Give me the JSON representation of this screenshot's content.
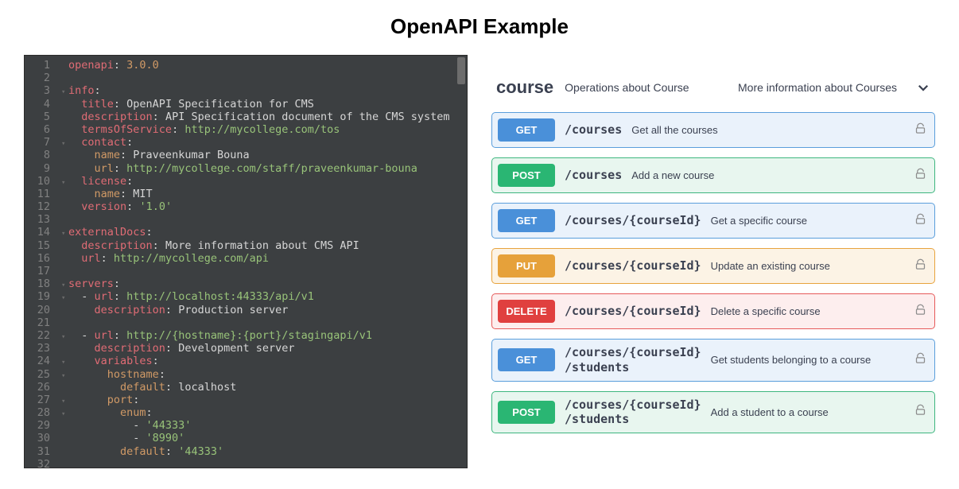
{
  "title": "OpenAPI Example",
  "editor": {
    "lines": [
      {
        "n": 1,
        "fold": "",
        "tokens": [
          [
            "k-red",
            "openapi"
          ],
          [
            "k-white",
            ": "
          ],
          [
            "k-orange",
            "3.0.0"
          ]
        ]
      },
      {
        "n": 2,
        "fold": "",
        "tokens": []
      },
      {
        "n": 3,
        "fold": "▾",
        "tokens": [
          [
            "k-red",
            "info"
          ],
          [
            "k-white",
            ":"
          ]
        ]
      },
      {
        "n": 4,
        "fold": "",
        "tokens": [
          [
            "k-white",
            "  "
          ],
          [
            "k-red",
            "title"
          ],
          [
            "k-white",
            ": "
          ],
          [
            "k-white",
            "OpenAPI Specification for CMS"
          ]
        ]
      },
      {
        "n": 5,
        "fold": "",
        "tokens": [
          [
            "k-white",
            "  "
          ],
          [
            "k-red",
            "description"
          ],
          [
            "k-white",
            ": "
          ],
          [
            "k-white",
            "API Specification document of the CMS system"
          ]
        ]
      },
      {
        "n": 6,
        "fold": "",
        "tokens": [
          [
            "k-white",
            "  "
          ],
          [
            "k-red",
            "termsOfService"
          ],
          [
            "k-white",
            ": "
          ],
          [
            "k-green",
            "http://mycollege.com/tos"
          ]
        ]
      },
      {
        "n": 7,
        "fold": "▾",
        "tokens": [
          [
            "k-white",
            "  "
          ],
          [
            "k-red",
            "contact"
          ],
          [
            "k-white",
            ":"
          ]
        ]
      },
      {
        "n": 8,
        "fold": "",
        "tokens": [
          [
            "k-white",
            "    "
          ],
          [
            "k-orange",
            "name"
          ],
          [
            "k-white",
            ": "
          ],
          [
            "k-white",
            "Praveenkumar Bouna"
          ]
        ]
      },
      {
        "n": 9,
        "fold": "",
        "tokens": [
          [
            "k-white",
            "    "
          ],
          [
            "k-orange",
            "url"
          ],
          [
            "k-white",
            ": "
          ],
          [
            "k-green",
            "http://mycollege.com/staff/praveenkumar-bouna"
          ]
        ]
      },
      {
        "n": 10,
        "fold": "▾",
        "tokens": [
          [
            "k-white",
            "  "
          ],
          [
            "k-red",
            "license"
          ],
          [
            "k-white",
            ":"
          ]
        ]
      },
      {
        "n": 11,
        "fold": "",
        "tokens": [
          [
            "k-white",
            "    "
          ],
          [
            "k-orange",
            "name"
          ],
          [
            "k-white",
            ": "
          ],
          [
            "k-white",
            "MIT"
          ]
        ]
      },
      {
        "n": 12,
        "fold": "",
        "tokens": [
          [
            "k-white",
            "  "
          ],
          [
            "k-red",
            "version"
          ],
          [
            "k-white",
            ": "
          ],
          [
            "k-green",
            "'1.0'"
          ]
        ]
      },
      {
        "n": 13,
        "fold": "",
        "tokens": []
      },
      {
        "n": 14,
        "fold": "▾",
        "tokens": [
          [
            "k-red",
            "externalDocs"
          ],
          [
            "k-white",
            ":"
          ]
        ]
      },
      {
        "n": 15,
        "fold": "",
        "tokens": [
          [
            "k-white",
            "  "
          ],
          [
            "k-red",
            "description"
          ],
          [
            "k-white",
            ": "
          ],
          [
            "k-white",
            "More information about CMS API"
          ]
        ]
      },
      {
        "n": 16,
        "fold": "",
        "tokens": [
          [
            "k-white",
            "  "
          ],
          [
            "k-red",
            "url"
          ],
          [
            "k-white",
            ": "
          ],
          [
            "k-green",
            "http://mycollege.com/api"
          ]
        ]
      },
      {
        "n": 17,
        "fold": "",
        "tokens": []
      },
      {
        "n": 18,
        "fold": "▾",
        "tokens": [
          [
            "k-red",
            "servers"
          ],
          [
            "k-white",
            ":"
          ]
        ]
      },
      {
        "n": 19,
        "fold": "▾",
        "tokens": [
          [
            "k-white",
            "  - "
          ],
          [
            "k-red",
            "url"
          ],
          [
            "k-white",
            ": "
          ],
          [
            "k-green",
            "http://localhost:44333/api/v1"
          ]
        ]
      },
      {
        "n": 20,
        "fold": "",
        "tokens": [
          [
            "k-white",
            "    "
          ],
          [
            "k-red",
            "description"
          ],
          [
            "k-white",
            ": "
          ],
          [
            "k-white",
            "Production server"
          ]
        ]
      },
      {
        "n": 21,
        "fold": "",
        "tokens": []
      },
      {
        "n": 22,
        "fold": "▾",
        "tokens": [
          [
            "k-white",
            "  - "
          ],
          [
            "k-red",
            "url"
          ],
          [
            "k-white",
            ": "
          ],
          [
            "k-green",
            "http://{hostname}:{port}/stagingapi/v1"
          ]
        ]
      },
      {
        "n": 23,
        "fold": "",
        "tokens": [
          [
            "k-white",
            "    "
          ],
          [
            "k-red",
            "description"
          ],
          [
            "k-white",
            ": "
          ],
          [
            "k-white",
            "Development server"
          ]
        ]
      },
      {
        "n": 24,
        "fold": "▾",
        "tokens": [
          [
            "k-white",
            "    "
          ],
          [
            "k-red",
            "variables"
          ],
          [
            "k-white",
            ":"
          ]
        ]
      },
      {
        "n": 25,
        "fold": "▾",
        "tokens": [
          [
            "k-white",
            "      "
          ],
          [
            "k-orange",
            "hostname"
          ],
          [
            "k-white",
            ":"
          ]
        ]
      },
      {
        "n": 26,
        "fold": "",
        "tokens": [
          [
            "k-white",
            "        "
          ],
          [
            "k-orange",
            "default"
          ],
          [
            "k-white",
            ": "
          ],
          [
            "k-white",
            "localhost"
          ]
        ]
      },
      {
        "n": 27,
        "fold": "▾",
        "tokens": [
          [
            "k-white",
            "      "
          ],
          [
            "k-orange",
            "port"
          ],
          [
            "k-white",
            ":"
          ]
        ]
      },
      {
        "n": 28,
        "fold": "▾",
        "tokens": [
          [
            "k-white",
            "        "
          ],
          [
            "k-orange",
            "enum"
          ],
          [
            "k-white",
            ":"
          ]
        ]
      },
      {
        "n": 29,
        "fold": "",
        "tokens": [
          [
            "k-white",
            "          - "
          ],
          [
            "k-green",
            "'44333'"
          ]
        ]
      },
      {
        "n": 30,
        "fold": "",
        "tokens": [
          [
            "k-white",
            "          - "
          ],
          [
            "k-green",
            "'8990'"
          ]
        ]
      },
      {
        "n": 31,
        "fold": "",
        "tokens": [
          [
            "k-white",
            "        "
          ],
          [
            "k-orange",
            "default"
          ],
          [
            "k-white",
            ": "
          ],
          [
            "k-green",
            "'44333'"
          ]
        ]
      },
      {
        "n": 32,
        "fold": "",
        "tokens": []
      }
    ]
  },
  "swagger": {
    "tag": {
      "name": "course",
      "description": "Operations about Course",
      "ext_link": "More information about Courses"
    },
    "operations": [
      {
        "method": "GET",
        "css": "get",
        "path": "/courses",
        "summary": "Get all the courses"
      },
      {
        "method": "POST",
        "css": "post",
        "path": "/courses",
        "summary": "Add a new course"
      },
      {
        "method": "GET",
        "css": "get",
        "path": "/courses/{courseId}",
        "summary": "Get a specific course"
      },
      {
        "method": "PUT",
        "css": "put",
        "path": "/courses/{courseId}",
        "summary": "Update an existing course"
      },
      {
        "method": "DELETE",
        "css": "delete",
        "path": "/courses/{courseId}",
        "summary": "Delete a specific course"
      },
      {
        "method": "GET",
        "css": "get",
        "path": "/courses/{courseId}",
        "path2": "/students",
        "summary": "Get students belonging to a course"
      },
      {
        "method": "POST",
        "css": "post",
        "path": "/courses/{courseId}",
        "path2": "/students",
        "summary": "Add a student to a course"
      }
    ]
  }
}
